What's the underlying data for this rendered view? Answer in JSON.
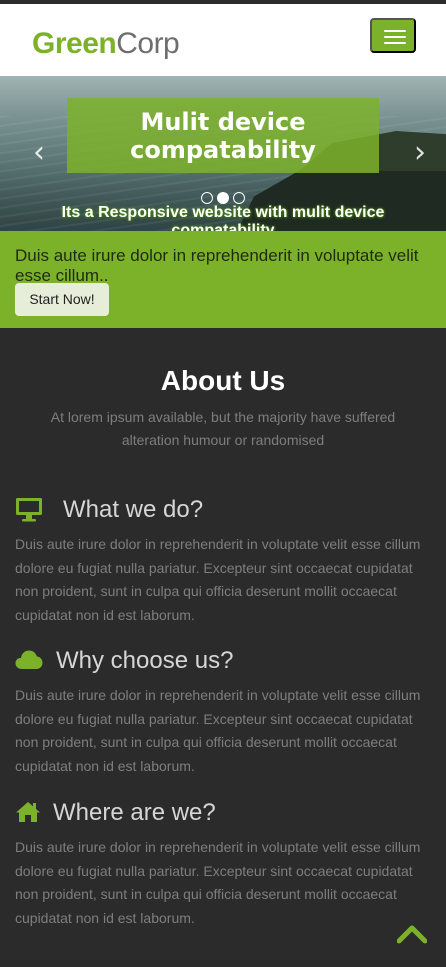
{
  "header": {
    "logo_green": "Green",
    "logo_gray": "Corp",
    "menu_icon": "hamburger-icon",
    "brand_color": "#7cb22a"
  },
  "hero": {
    "caption_title_line1": "Mulit device",
    "caption_title_line2": "compatability",
    "subtitle": "Its a Responsive website with mulit device compatability",
    "prev_icon": "chevron-left-icon",
    "next_icon": "chevron-right-icon",
    "slides_count": 3,
    "active_slide": 2
  },
  "promo": {
    "text": "Duis aute irure dolor in reprehenderit in voluptate velit esse cillum..",
    "button_label": "Start Now!"
  },
  "about": {
    "title": "About Us",
    "subtitle": "At lorem ipsum available, but the majority have suffered alteration humour or randomised"
  },
  "features": [
    {
      "icon": "desktop-icon",
      "title": "What we do?",
      "body": "Duis aute irure dolor in reprehenderit in voluptate velit esse cillum dolore eu fugiat nulla pariatur. Excepteur sint occaecat cupidatat non proident, sunt in culpa qui officia deserunt mollit occaecat cupidatat non id est laborum."
    },
    {
      "icon": "cloud-icon",
      "title": "Why choose us?",
      "body": "Duis aute irure dolor in reprehenderit in voluptate velit esse cillum dolore eu fugiat nulla pariatur. Excepteur sint occaecat cupidatat non proident, sunt in culpa qui officia deserunt mollit occaecat cupidatat non id est laborum."
    },
    {
      "icon": "home-icon",
      "title": "Where are we?",
      "body": "Duis aute irure dolor in reprehenderit in voluptate velit esse cillum dolore eu fugiat nulla pariatur. Excepteur sint occaecat cupidatat non proident, sunt in culpa qui officia deserunt mollit occaecat cupidatat non id est laborum."
    }
  ],
  "footer": {
    "back_to_top_icon": "chevron-up-icon"
  }
}
